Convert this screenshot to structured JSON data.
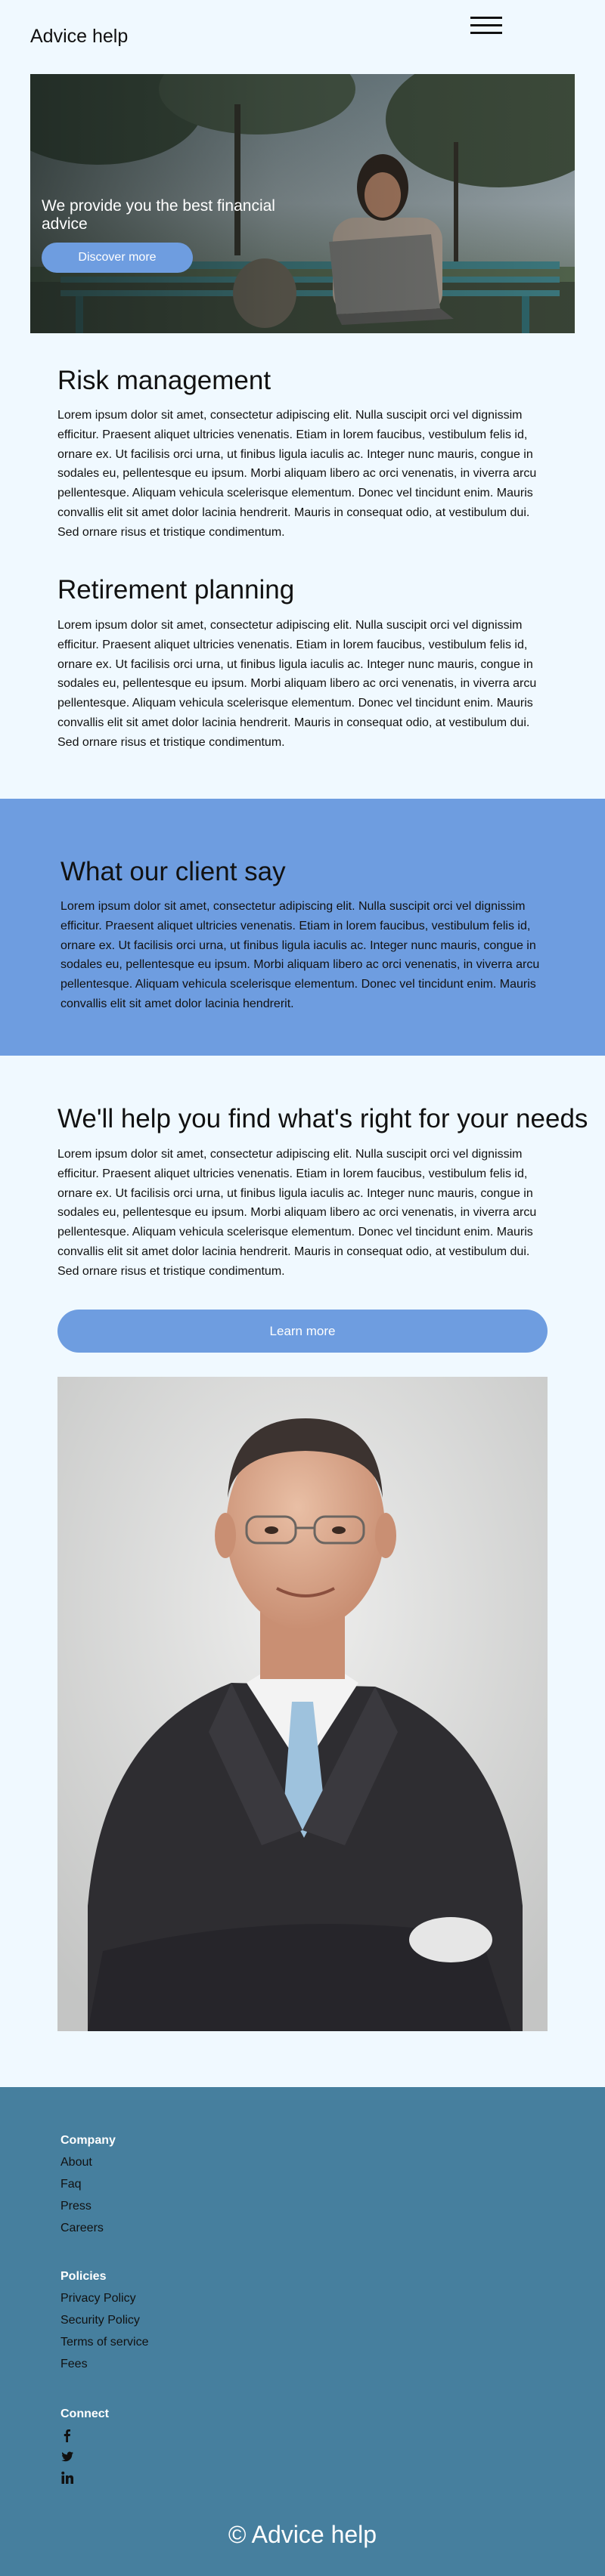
{
  "header": {
    "logo": "Advice help",
    "menu_icon": "hamburger-menu-icon"
  },
  "hero": {
    "title": "We provide you the best financial advice",
    "button_label": "Discover more"
  },
  "sections": [
    {
      "title": "Risk management",
      "text": "Lorem ipsum dolor sit amet, consectetur adipiscing elit. Nulla suscipit orci vel dignissim efficitur. Praesent aliquet ultricies venenatis. Etiam in lorem faucibus, vestibulum felis id, ornare ex. Ut facilisis orci urna, ut finibus ligula iaculis ac. Integer nunc mauris, congue in sodales eu, pellentesque eu ipsum. Morbi aliquam libero ac orci venenatis, in viverra arcu pellentesque. Aliquam vehicula scelerisque elementum. Donec vel tincidunt enim. Mauris convallis elit sit amet dolor lacinia hendrerit. Mauris in consequat odio, at vestibulum dui. Sed ornare risus et tristique condimentum."
    },
    {
      "title": "Retirement planning",
      "text": "Lorem ipsum dolor sit amet, consectetur adipiscing elit. Nulla suscipit orci vel dignissim efficitur. Praesent aliquet ultricies venenatis. Etiam in lorem faucibus, vestibulum felis id, ornare ex. Ut facilisis orci urna, ut finibus ligula iaculis ac. Integer nunc mauris, congue in sodales eu, pellentesque eu ipsum. Morbi aliquam libero ac orci venenatis, in viverra arcu pellentesque. Aliquam vehicula scelerisque elementum. Donec vel tincidunt enim. Mauris convallis elit sit amet dolor lacinia hendrerit. Mauris in consequat odio, at vestibulum dui. Sed ornare risus et tristique condimentum."
    }
  ],
  "testimonial": {
    "title": "What our client say",
    "text": "Lorem ipsum dolor sit amet, consectetur adipiscing elit. Nulla suscipit orci vel dignissim efficitur. Praesent aliquet ultricies venenatis. Etiam in lorem faucibus, vestibulum felis id, ornare ex. Ut facilisis orci urna, ut finibus ligula iaculis ac. Integer nunc mauris, congue in sodales eu, pellentesque eu ipsum. Morbi aliquam libero ac orci venenatis, in viverra arcu pellentesque. Aliquam vehicula scelerisque elementum. Donec vel tincidunt enim. Mauris convallis elit sit amet dolor lacinia hendrerit."
  },
  "needs": {
    "title": "We'll help you find what's right for your needs",
    "text": "Lorem ipsum dolor sit amet, consectetur adipiscing elit. Nulla suscipit orci vel dignissim efficitur. Praesent aliquet ultricies venenatis. Etiam in lorem faucibus, vestibulum felis id, ornare ex. Ut facilisis orci urna, ut finibus ligula iaculis ac. Integer nunc mauris, congue in sodales eu, pellentesque eu ipsum. Morbi aliquam libero ac orci venenatis, in viverra arcu pellentesque. Aliquam vehicula scelerisque elementum. Donec vel tincidunt enim. Mauris convallis elit sit amet dolor lacinia hendrerit. Mauris in consequat odio, at vestibulum dui. Sed ornare risus et tristique condimentum.",
    "button_label": "Learn more"
  },
  "footer": {
    "company": {
      "heading": "Company",
      "links": [
        "About",
        "Faq",
        "Press",
        "Careers"
      ]
    },
    "policies": {
      "heading": "Policies",
      "links": [
        "Privacy Policy",
        "Security Policy",
        "Terms of service",
        "Fees"
      ]
    },
    "connect": {
      "heading": "Connect",
      "icons": [
        "facebook-icon",
        "twitter-icon",
        "linkedin-icon"
      ]
    },
    "copyright": "© Advice help"
  },
  "colors": {
    "background": "#f0f9ff",
    "accent": "#6e9de0",
    "footer": "#467f9e"
  }
}
